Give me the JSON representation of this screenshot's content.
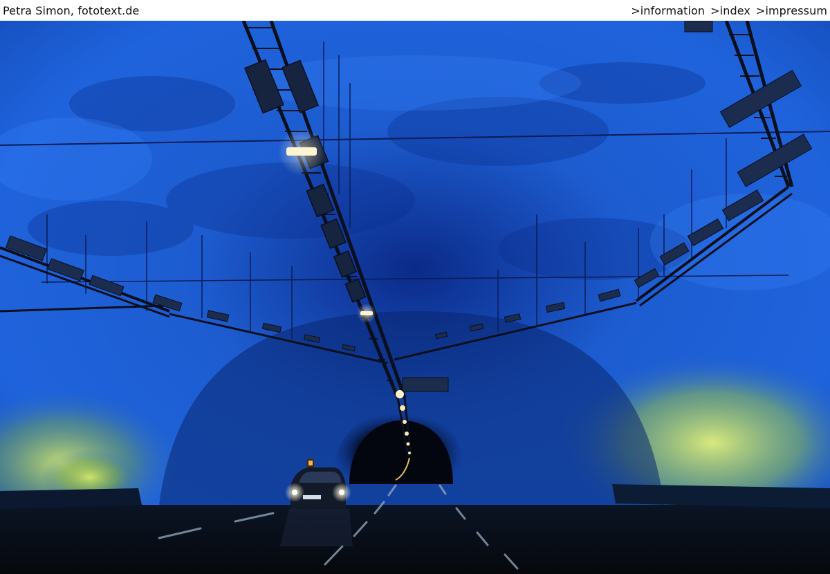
{
  "header": {
    "site_title": "Petra Simon, fototext.de",
    "nav": [
      {
        "label": ">information"
      },
      {
        "label": ">index"
      },
      {
        "label": ">impressum"
      }
    ]
  },
  "photo": {
    "subject": "illuminated blue road tunnel with a car and headlights",
    "colors": {
      "rock_blue": "#1e63d6",
      "rock_dark": "#0b1e5e",
      "glow_yellow": "#d9ee6a",
      "road": "#0e1219"
    }
  }
}
